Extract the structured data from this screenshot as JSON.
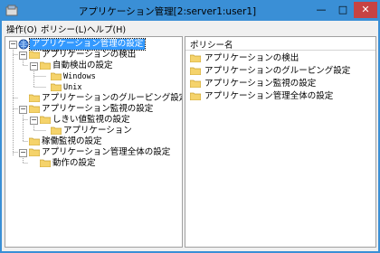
{
  "window": {
    "title": "アプリケーション管理[2:server1:user1]",
    "controls": {
      "minimize": "—",
      "maximize": "□",
      "close": "✕"
    }
  },
  "menu": {
    "operations": "操作(O)",
    "policy": "ポリシー(L)",
    "help": "ヘルプ(H)"
  },
  "tree": {
    "root": "アプリケーション管理の設定",
    "detection": "アプリケーションの検出",
    "auto_detection": "自動検出の設定",
    "windows": "Windows",
    "unix": "Unix",
    "grouping": "アプリケーションのグルーピング設定",
    "monitoring": "アプリケーション監視の設定",
    "threshold": "しきい値監視の設定",
    "threshold_app": "アプリケーション",
    "operation_monitoring": "稼働監視の設定",
    "overall": "アプリケーション管理全体の設定",
    "behavior": "動作の設定"
  },
  "list": {
    "column_header": "ポリシー名",
    "items": [
      "アプリケーションの検出",
      "アプリケーションのグルーピング設定",
      "アプリケーション監視の設定",
      "アプリケーション管理全体の設定"
    ]
  }
}
